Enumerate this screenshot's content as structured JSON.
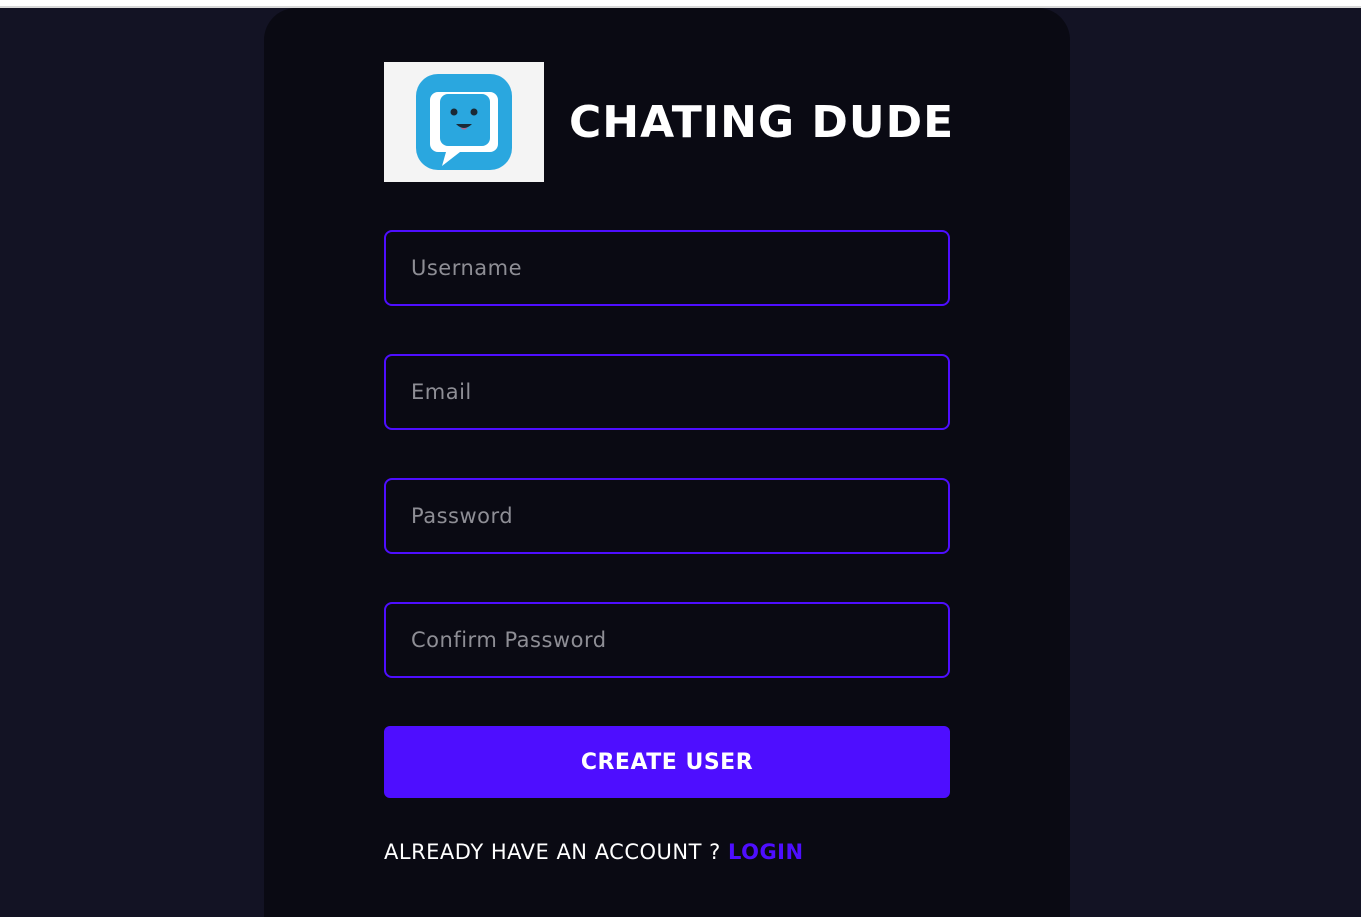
{
  "brand": {
    "title": "CHATING DUDE",
    "logo_icon": "chat-bubble-face-icon"
  },
  "form": {
    "username_placeholder": "Username",
    "email_placeholder": "Email",
    "password_placeholder": "Password",
    "confirm_password_placeholder": "Confirm Password",
    "submit_label": "CREATE USER"
  },
  "footer": {
    "prompt": "ALREADY HAVE AN ACCOUNT ? ",
    "link_label": "LOGIN"
  },
  "colors": {
    "background": "#131324",
    "card": "#0a0a13",
    "accent": "#4e0eff",
    "text": "#ffffff",
    "placeholder": "#8e8e95"
  }
}
